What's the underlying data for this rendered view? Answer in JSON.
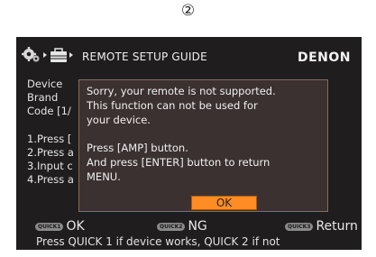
{
  "step_marker": "②",
  "header": {
    "title": "REMOTE SETUP GUIDE",
    "brand": "DENON"
  },
  "background": {
    "line1": "Device",
    "line2": "Brand",
    "line3": "Code [1/",
    "steps": [
      "1.Press [",
      "2.Press a",
      "3.Input c",
      "4.Press a"
    ]
  },
  "dialog": {
    "lines": [
      "Sorry, your remote is not supported.",
      "This function can not be used for",
      "your device.",
      "Press [AMP] button.",
      "And press [ENTER] button to return",
      "MENU."
    ],
    "ok_label": "OK"
  },
  "quick_bar": {
    "q1_badge": "QUICK1",
    "q1_label": "OK",
    "q2_badge": "QUICK2",
    "q2_label": "NG",
    "q3_badge": "QUICK3",
    "q3_label": "Return"
  },
  "footer_hint": "Press QUICK 1 if device works, QUICK 2 if not"
}
